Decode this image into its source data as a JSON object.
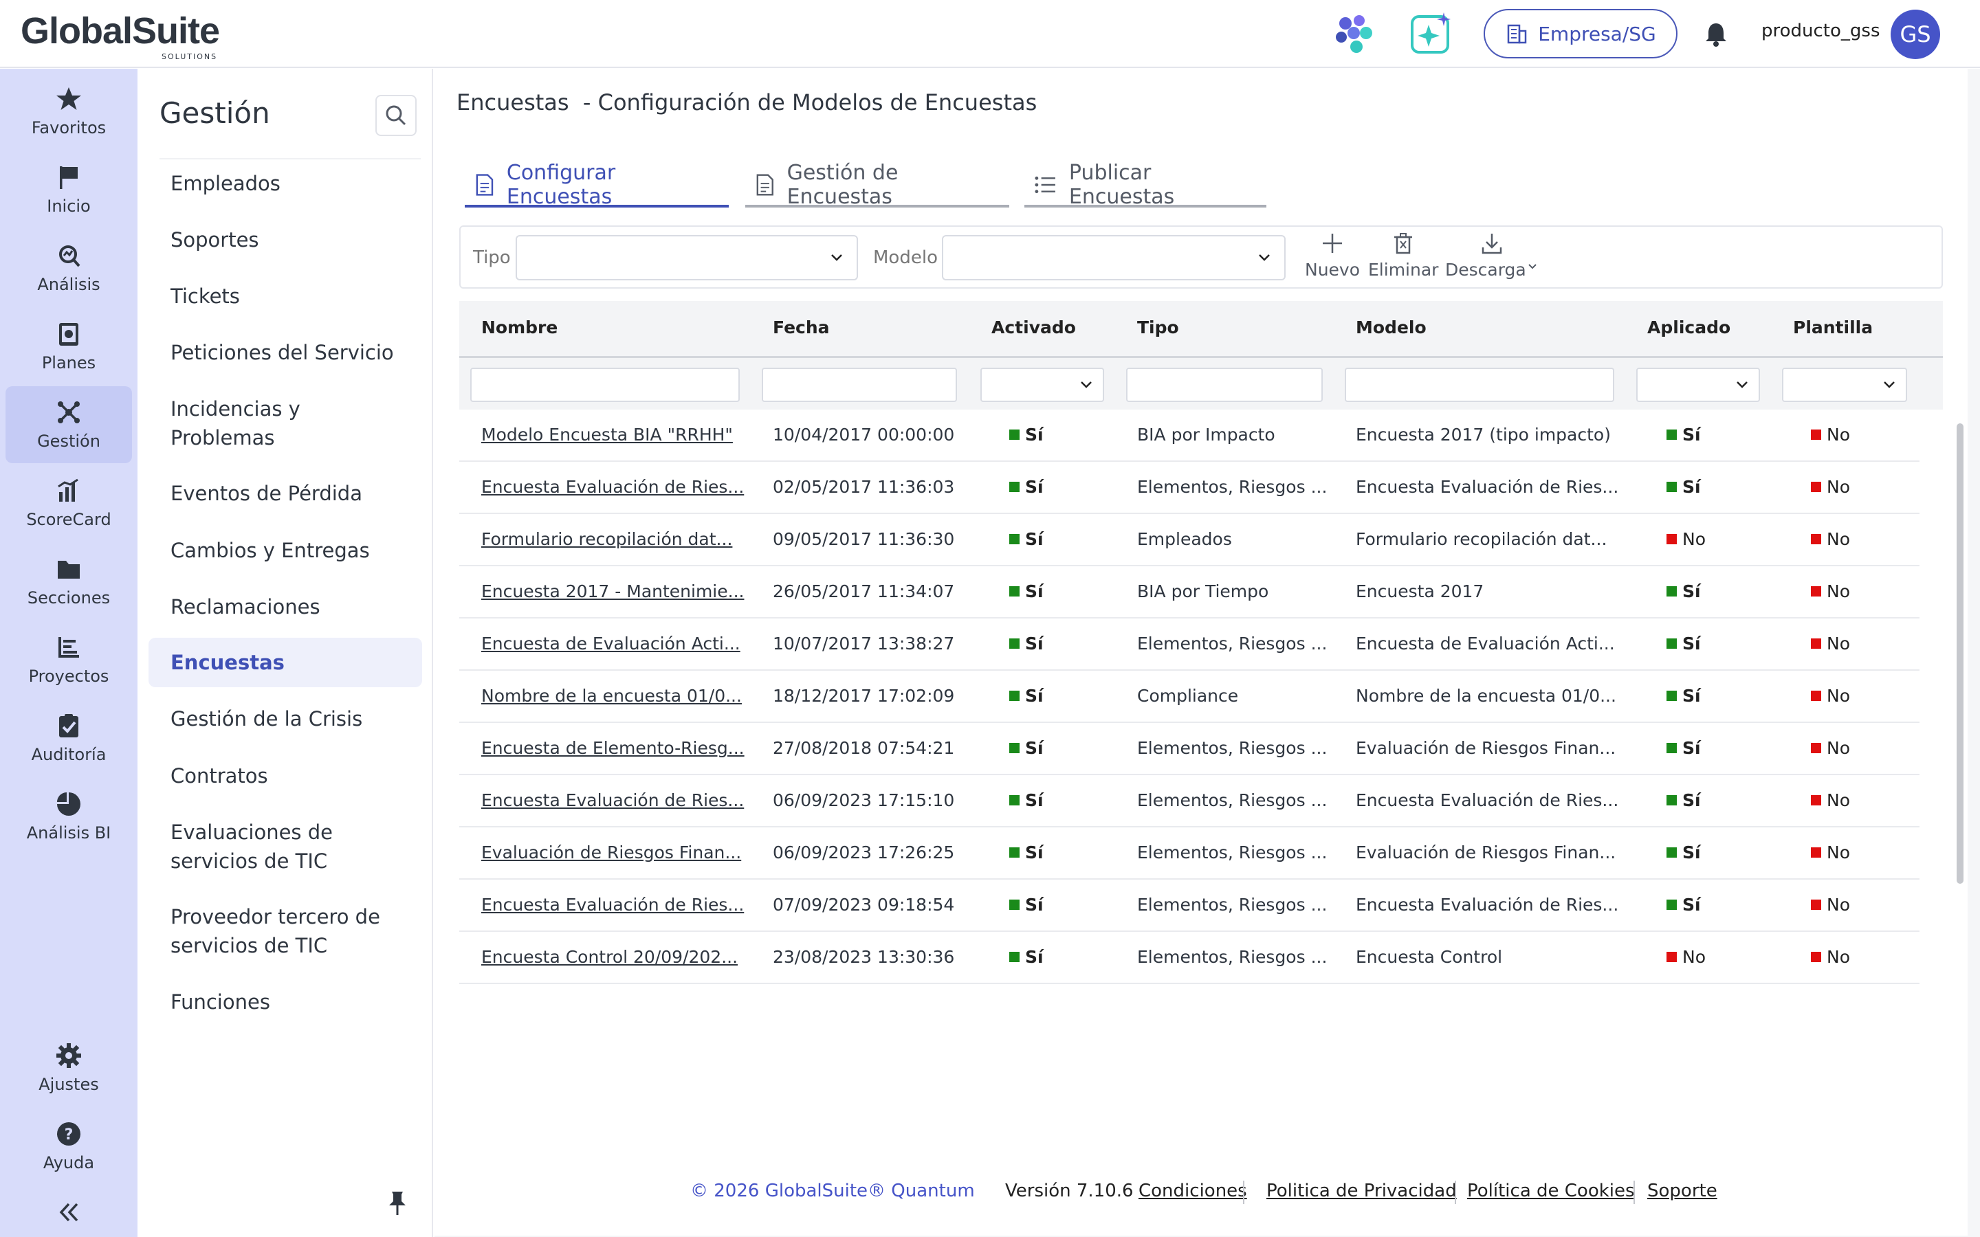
{
  "brand": {
    "name": "GlobalSuite",
    "sub": "SOLUTIONS"
  },
  "topbar": {
    "company_button": "Empresa/SG",
    "username": "producto_gss",
    "avatar_initials": "GS"
  },
  "rail": {
    "items": [
      {
        "label": "Favoritos",
        "icon": "star-icon"
      },
      {
        "label": "Inicio",
        "icon": "flag-icon"
      },
      {
        "label": "Análisis",
        "icon": "analysis-icon"
      },
      {
        "label": "Planes",
        "icon": "planes-icon"
      },
      {
        "label": "Gestión",
        "icon": "gestion-icon"
      },
      {
        "label": "ScoreCard",
        "icon": "chart-bars-icon"
      },
      {
        "label": "Secciones",
        "icon": "folder-icon"
      },
      {
        "label": "Proyectos",
        "icon": "projects-icon"
      },
      {
        "label": "Auditoría",
        "icon": "clipboard-check-icon"
      },
      {
        "label": "Análisis BI",
        "icon": "pie-icon"
      }
    ],
    "bottom": [
      {
        "label": "Ajustes",
        "icon": "gear-icon"
      },
      {
        "label": "Ayuda",
        "icon": "help-icon"
      }
    ]
  },
  "subnav": {
    "title": "Gestión",
    "items": [
      "Empleados",
      "Soportes",
      "Tickets",
      "Peticiones del Servicio",
      "Incidencias y\nProblemas",
      "Eventos de Pérdida",
      "Cambios y Entregas",
      "Reclamaciones",
      "Encuestas",
      "Gestión de la Crisis",
      "Contratos",
      "Evaluaciones de\nservicios de TIC",
      "Proveedor tercero de\nservicios de TIC",
      "Funciones"
    ],
    "active": "Encuestas"
  },
  "page": {
    "title": "Encuestas  - Configuración de Modelos de Encuestas",
    "tabs": [
      "Configurar Encuestas",
      "Gestión de Encuestas",
      "Publicar Encuestas"
    ],
    "active_tab": "Configurar Encuestas"
  },
  "filters": {
    "tipo_label": "Tipo",
    "tipo_value": "",
    "modelo_label": "Modelo",
    "modelo_value": "",
    "tools": [
      "Nuevo",
      "Eliminar",
      "Descarga"
    ]
  },
  "table": {
    "columns": [
      "Nombre",
      "Fecha",
      "Activado",
      "Tipo",
      "Modelo",
      "Aplicado",
      "Plantilla"
    ],
    "rows": [
      {
        "nombre": "Modelo Encuesta BIA \"RRHH\"",
        "fecha": "10/04/2017 00:00:00",
        "activado": "Sí",
        "tipo": "BIA por Impacto",
        "modelo": "Encuesta 2017 (tipo impacto)",
        "aplicado": "Sí",
        "plantilla": "No"
      },
      {
        "nombre": "Encuesta Evaluación de Ries...",
        "fecha": "02/05/2017 11:36:03",
        "activado": "Sí",
        "tipo": "Elementos, Riesgos ...",
        "modelo": "Encuesta Evaluación de Ries...",
        "aplicado": "Sí",
        "plantilla": "No"
      },
      {
        "nombre": "Formulario recopilación dat...",
        "fecha": "09/05/2017 11:36:30",
        "activado": "Sí",
        "tipo": "Empleados",
        "modelo": "Formulario recopilación dat...",
        "aplicado": "No",
        "plantilla": "No"
      },
      {
        "nombre": "Encuesta 2017 - Mantenimie...",
        "fecha": "26/05/2017 11:34:07",
        "activado": "Sí",
        "tipo": "BIA por Tiempo",
        "modelo": "Encuesta 2017",
        "aplicado": "Sí",
        "plantilla": "No"
      },
      {
        "nombre": "Encuesta de Evaluación Acti...",
        "fecha": "10/07/2017 13:38:27",
        "activado": "Sí",
        "tipo": "Elementos, Riesgos ...",
        "modelo": "Encuesta de Evaluación Acti...",
        "aplicado": "Sí",
        "plantilla": "No"
      },
      {
        "nombre": "Nombre de la encuesta 01/0...",
        "fecha": "18/12/2017 17:02:09",
        "activado": "Sí",
        "tipo": "Compliance",
        "modelo": "Nombre de la encuesta 01/0...",
        "aplicado": "Sí",
        "plantilla": "No"
      },
      {
        "nombre": "Encuesta de Elemento-Riesg...",
        "fecha": "27/08/2018 07:54:21",
        "activado": "Sí",
        "tipo": "Elementos, Riesgos ...",
        "modelo": "Evaluación de Riesgos Finan...",
        "aplicado": "Sí",
        "plantilla": "No"
      },
      {
        "nombre": "Encuesta Evaluación de Ries...",
        "fecha": "06/09/2023 17:15:10",
        "activado": "Sí",
        "tipo": "Elementos, Riesgos ...",
        "modelo": "Encuesta Evaluación de Ries...",
        "aplicado": "Sí",
        "plantilla": "No"
      },
      {
        "nombre": "Evaluación de Riesgos Finan...",
        "fecha": "06/09/2023 17:26:25",
        "activado": "Sí",
        "tipo": "Elementos, Riesgos ...",
        "modelo": "Evaluación de Riesgos Finan...",
        "aplicado": "Sí",
        "plantilla": "No"
      },
      {
        "nombre": "Encuesta Evaluación de Ries...",
        "fecha": "07/09/2023 09:18:54",
        "activado": "Sí",
        "tipo": "Elementos, Riesgos ...",
        "modelo": "Encuesta Evaluación de Ries...",
        "aplicado": "Sí",
        "plantilla": "No"
      },
      {
        "nombre": "Encuesta Control 20/09/202...",
        "fecha": "23/08/2023 13:30:36",
        "activado": "Sí",
        "tipo": "Elementos, Riesgos ...",
        "modelo": "Encuesta Control",
        "aplicado": "No",
        "plantilla": "No"
      }
    ]
  },
  "footer": {
    "copyright": "© 2026 GlobalSuite® Quantum",
    "version": "Versión 7.10.6",
    "links": [
      "Condiciones",
      "Politica de Privacidad",
      "Política de Cookies",
      "Soporte"
    ]
  },
  "colors": {
    "accent": "#3f50b5",
    "rail_bg": "#d8dcfa",
    "yes": "#1a8a1a",
    "no": "#e01010"
  }
}
